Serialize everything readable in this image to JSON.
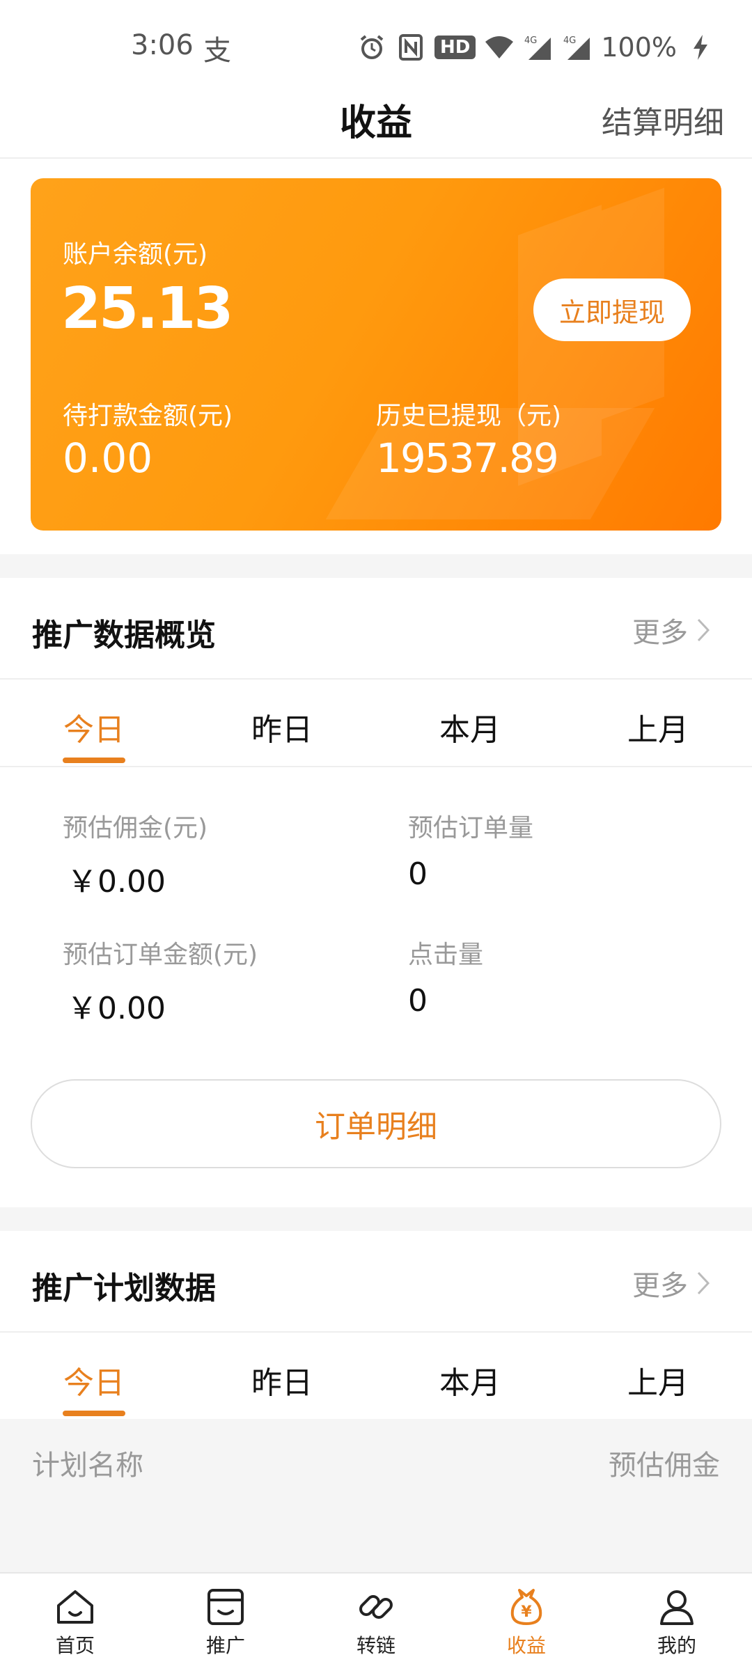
{
  "status_bar": {
    "time": "3:06",
    "app_icon": "alipay-icon",
    "battery": "100%",
    "hd": "HD"
  },
  "header": {
    "title": "收益",
    "right_link": "结算明细"
  },
  "balance_card": {
    "balance_label": "账户余额(元)",
    "balance_value": "25.13",
    "withdraw_button": "立即提现",
    "pending_label": "待打款金额(元)",
    "pending_value": "0.00",
    "history_label": "历史已提现（元)",
    "history_value": "19537.89"
  },
  "overview": {
    "title": "推广数据概览",
    "more": "更多",
    "tabs": [
      "今日",
      "昨日",
      "本月",
      "上月"
    ],
    "active_tab": 0,
    "stats": [
      {
        "label": "预估佣金(元)",
        "value": "￥0.00"
      },
      {
        "label": "预估订单量",
        "value": "0"
      },
      {
        "label": "预估订单金额(元)",
        "value": "￥0.00"
      },
      {
        "label": "点击量",
        "value": "0"
      }
    ],
    "order_button": "订单明细"
  },
  "plan": {
    "title": "推广计划数据",
    "more": "更多",
    "tabs": [
      "今日",
      "昨日",
      "本月",
      "上月"
    ],
    "active_tab": 0,
    "table_headers": [
      "计划名称",
      "预估佣金"
    ]
  },
  "bottom_nav": {
    "items": [
      {
        "label": "首页",
        "icon": "home-icon"
      },
      {
        "label": "推广",
        "icon": "store-icon"
      },
      {
        "label": "转链",
        "icon": "link-icon"
      },
      {
        "label": "收益",
        "icon": "money-bag-icon"
      },
      {
        "label": "我的",
        "icon": "user-icon"
      }
    ],
    "active": 3
  },
  "colors": {
    "accent": "#e8801e",
    "card_start": "#ffa21a",
    "card_end": "#ff7a00"
  }
}
